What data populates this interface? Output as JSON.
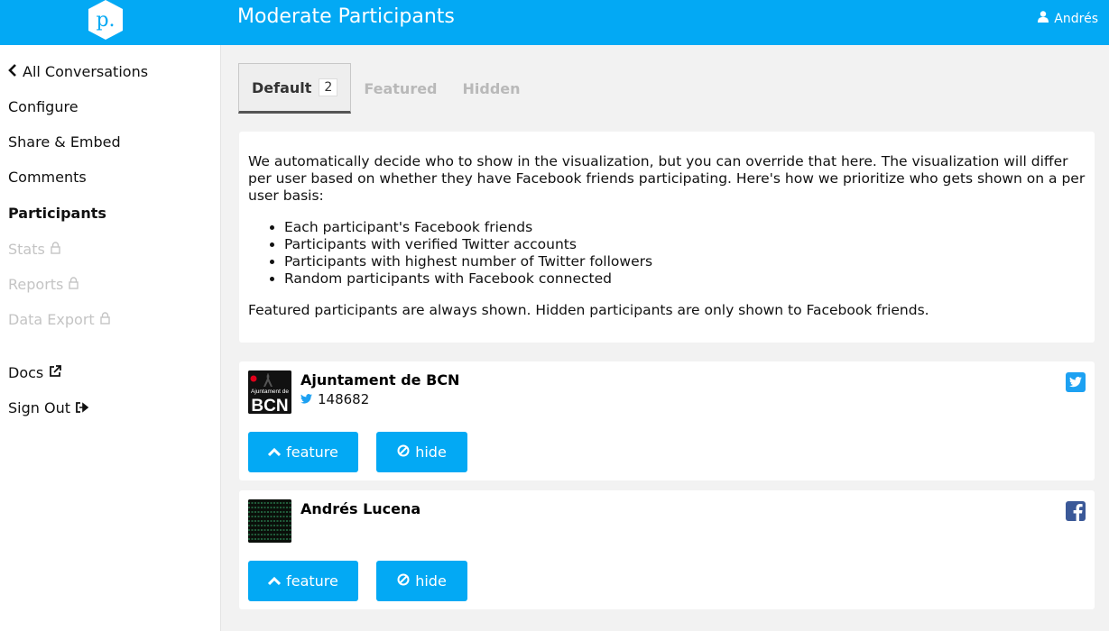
{
  "header": {
    "title": "Moderate Participants",
    "logo_text": "p.",
    "user_name": "Andrés"
  },
  "sidebar": {
    "items": [
      {
        "label": "All Conversations",
        "icon": "chevron-left-icon"
      },
      {
        "label": "Configure"
      },
      {
        "label": "Share & Embed"
      },
      {
        "label": "Comments"
      },
      {
        "label": "Participants",
        "active": true
      },
      {
        "label": "Stats",
        "locked": true,
        "icon": "lock-icon"
      },
      {
        "label": "Reports",
        "locked": true,
        "icon": "lock-icon"
      },
      {
        "label": "Data Export",
        "locked": true,
        "icon": "lock-icon"
      },
      {
        "label": "Docs",
        "icon": "external-link-icon"
      },
      {
        "label": "Sign Out",
        "icon": "sign-out-icon"
      }
    ]
  },
  "tabs": [
    {
      "label": "Default",
      "count": "2",
      "active": true
    },
    {
      "label": "Featured"
    },
    {
      "label": "Hidden"
    }
  ],
  "info": {
    "intro": "We automatically decide who to show in the visualization, but you can override that here. The visualization will differ per user based on whether they have Facebook friends participating. Here's how we prioritize who gets shown on a per user basis:",
    "bullets": [
      "Each participant's Facebook friends",
      "Participants with verified Twitter accounts",
      "Participants with highest number of Twitter followers",
      "Random participants with Facebook connected"
    ],
    "footer": "Featured participants are always shown. Hidden participants are only shown to Facebook friends."
  },
  "participants": [
    {
      "name": "Ajuntament de BCN",
      "followers": "148682",
      "source": "twitter",
      "avatar_text_top": "Ajuntament de",
      "avatar_text_main": "BCN"
    },
    {
      "name": "Andrés Lucena",
      "followers": "",
      "source": "facebook"
    }
  ],
  "buttons": {
    "feature_label": "feature",
    "hide_label": "hide"
  },
  "colors": {
    "accent": "#03a9f4",
    "twitter": "#1da1f2",
    "facebook": "#3b5998"
  }
}
